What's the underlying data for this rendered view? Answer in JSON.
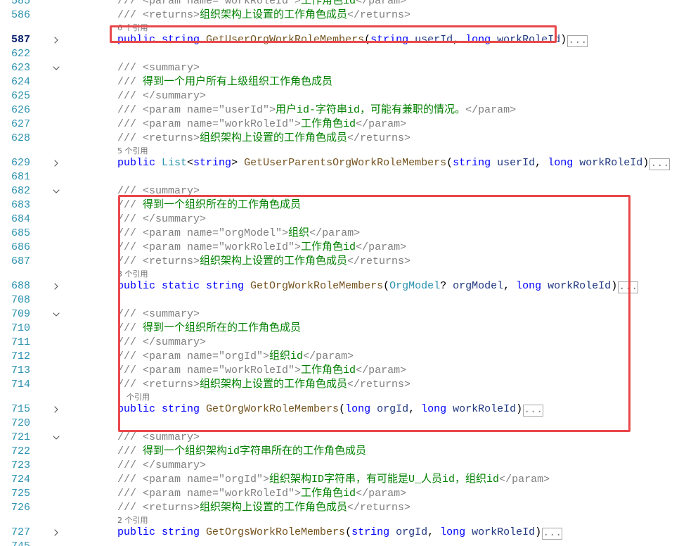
{
  "theme": {
    "background": "#FFFFFF",
    "line_number": "#2B91AF",
    "current_line_number": "#0B216F",
    "keyword": "#0000FF",
    "method": "#74531F",
    "type": "#2B91AF",
    "param": "#1F377F",
    "punct": "#000000",
    "doc_tag": "#808080",
    "doc_text": "#008000",
    "codelens": "#6F6F6F",
    "fold_chevron": "#5A5A5A",
    "ellipsis_border": "#A5A5A5",
    "ellipsis_text": "#808080",
    "annotation": "#E8484B"
  },
  "editor": {
    "lines": [
      {
        "num": "585",
        "tokens": [
          {
            "doc_tag": "/// <param name=\"workRoleId\">"
          },
          {
            "doc_text": "工作角色id"
          },
          {
            "doc_tag": "</param>"
          }
        ]
      },
      {
        "num": "586",
        "tokens": [
          {
            "doc_tag": "/// <returns>"
          },
          {
            "doc_text": "组织架构上设置的工作角色成员"
          },
          {
            "doc_tag": "</returns>"
          }
        ]
      },
      {
        "num": "587",
        "current": true,
        "fold_icon": "chevron-right-icon",
        "codelens": "6 个引用",
        "tokens": [
          {
            "keyword": "public "
          },
          {
            "keyword": "string "
          },
          {
            "method": "GetUserOrgWorkRoleMembers"
          },
          {
            "punct": "("
          },
          {
            "keyword": "string "
          },
          {
            "param": "userId"
          },
          {
            "punct": ", "
          },
          {
            "keyword": "long "
          },
          {
            "param": "workRoleId"
          },
          {
            "punct": ")"
          }
        ],
        "ellipsis": "..."
      },
      {
        "num": "622",
        "tokens": []
      },
      {
        "num": "623",
        "fold_icon": "chevron-down-icon",
        "tokens": [
          {
            "doc_tag": "/// <summary>"
          }
        ]
      },
      {
        "num": "624",
        "tokens": [
          {
            "doc_tag": "/// "
          },
          {
            "doc_text": "得到一个用户所有上级组织工作角色成员"
          }
        ]
      },
      {
        "num": "625",
        "tokens": [
          {
            "doc_tag": "/// </summary>"
          }
        ]
      },
      {
        "num": "626",
        "tokens": [
          {
            "doc_tag": "/// <param name=\"userId\">"
          },
          {
            "doc_text": "用户id-字符串id，可能有兼职的情况。"
          },
          {
            "doc_tag": "</param>"
          }
        ]
      },
      {
        "num": "627",
        "tokens": [
          {
            "doc_tag": "/// <param name=\"workRoleId\">"
          },
          {
            "doc_text": "工作角色id"
          },
          {
            "doc_tag": "</param>"
          }
        ]
      },
      {
        "num": "628",
        "tokens": [
          {
            "doc_tag": "/// <returns>"
          },
          {
            "doc_text": "组织架构上设置的工作角色成员"
          },
          {
            "doc_tag": "</returns>"
          }
        ]
      },
      {
        "num": "629",
        "fold_icon": "chevron-right-icon",
        "codelens": "5 个引用",
        "tokens": [
          {
            "keyword": "public "
          },
          {
            "type": "List"
          },
          {
            "punct": "<"
          },
          {
            "keyword": "string"
          },
          {
            "punct": "> "
          },
          {
            "method": "GetUserParentsOrgWorkRoleMembers"
          },
          {
            "punct": "("
          },
          {
            "keyword": "string "
          },
          {
            "param": "userId"
          },
          {
            "punct": ", "
          },
          {
            "keyword": "long "
          },
          {
            "param": "workRoleId"
          },
          {
            "punct": ")"
          }
        ],
        "ellipsis": "..."
      },
      {
        "num": "681",
        "tokens": []
      },
      {
        "num": "682",
        "fold_icon": "chevron-down-icon",
        "tokens": [
          {
            "doc_tag": "/// <summary>"
          }
        ]
      },
      {
        "num": "683",
        "tokens": [
          {
            "doc_tag": "/// "
          },
          {
            "doc_text": "得到一个组织所在的工作角色成员"
          }
        ]
      },
      {
        "num": "684",
        "tokens": [
          {
            "doc_tag": "/// </summary>"
          }
        ]
      },
      {
        "num": "685",
        "tokens": [
          {
            "doc_tag": "/// <param name=\"orgModel\">"
          },
          {
            "doc_text": "组织"
          },
          {
            "doc_tag": "</param>"
          }
        ]
      },
      {
        "num": "686",
        "tokens": [
          {
            "doc_tag": "/// <param name=\"workRoleId\">"
          },
          {
            "doc_text": "工作角色id"
          },
          {
            "doc_tag": "</param>"
          }
        ]
      },
      {
        "num": "687",
        "tokens": [
          {
            "doc_tag": "/// <returns>"
          },
          {
            "doc_text": "组织架构上设置的工作角色成员"
          },
          {
            "doc_tag": "</returns>"
          }
        ]
      },
      {
        "num": "688",
        "fold_icon": "chevron-right-icon",
        "codelens": "3 个引用",
        "tokens": [
          {
            "keyword": "public "
          },
          {
            "keyword": "static "
          },
          {
            "keyword": "string "
          },
          {
            "method": "GetOrgWorkRoleMembers"
          },
          {
            "punct": "("
          },
          {
            "type": "OrgModel"
          },
          {
            "punct": "? "
          },
          {
            "param": "orgModel"
          },
          {
            "punct": ", "
          },
          {
            "keyword": "long "
          },
          {
            "param": "workRoleId"
          },
          {
            "punct": ")"
          }
        ],
        "ellipsis": "..."
      },
      {
        "num": "708",
        "tokens": []
      },
      {
        "num": "709",
        "fold_icon": "chevron-down-icon",
        "tokens": [
          {
            "doc_tag": "/// <summary>"
          }
        ]
      },
      {
        "num": "710",
        "tokens": [
          {
            "doc_tag": "/// "
          },
          {
            "doc_text": "得到一个组织所在的工作角色成员"
          }
        ]
      },
      {
        "num": "711",
        "tokens": [
          {
            "doc_tag": "/// </summary>"
          }
        ]
      },
      {
        "num": "712",
        "tokens": [
          {
            "doc_tag": "/// <param name=\"orgId\">"
          },
          {
            "doc_text": "组织id"
          },
          {
            "doc_tag": "</param>"
          }
        ]
      },
      {
        "num": "713",
        "tokens": [
          {
            "doc_tag": "/// <param name=\"workRoleId\">"
          },
          {
            "doc_text": "工作角色id"
          },
          {
            "doc_tag": "</param>"
          }
        ]
      },
      {
        "num": "714",
        "tokens": [
          {
            "doc_tag": "/// <returns>"
          },
          {
            "doc_text": "组织架构上设置的工作角色成员"
          },
          {
            "doc_tag": "</returns>"
          }
        ]
      },
      {
        "num": "715",
        "fold_icon": "chevron-right-icon",
        "codelens": "个引用",
        "tokens": [
          {
            "keyword": "public "
          },
          {
            "keyword": "string "
          },
          {
            "method": "GetOrgWorkRoleMembers"
          },
          {
            "punct": "("
          },
          {
            "keyword": "long "
          },
          {
            "param": "orgId"
          },
          {
            "punct": ", "
          },
          {
            "keyword": "long "
          },
          {
            "param": "workRoleId"
          },
          {
            "punct": ")"
          }
        ],
        "ellipsis": "..."
      },
      {
        "num": "720",
        "tokens": []
      },
      {
        "num": "721",
        "fold_icon": "chevron-down-icon",
        "tokens": [
          {
            "doc_tag": "/// <summary>"
          }
        ]
      },
      {
        "num": "722",
        "tokens": [
          {
            "doc_tag": "/// "
          },
          {
            "doc_text": "得到一个组织架构id字符串所在的工作角色成员"
          }
        ]
      },
      {
        "num": "723",
        "tokens": [
          {
            "doc_tag": "/// </summary>"
          }
        ]
      },
      {
        "num": "724",
        "tokens": [
          {
            "doc_tag": "/// <param name=\"orgId\">"
          },
          {
            "doc_text": "组织架构ID字符串，有可能是U_人员id，组织id"
          },
          {
            "doc_tag": "</param>"
          }
        ]
      },
      {
        "num": "725",
        "tokens": [
          {
            "doc_tag": "/// <param name=\"workRoleId\">"
          },
          {
            "doc_text": "工作角色id"
          },
          {
            "doc_tag": "</param>"
          }
        ]
      },
      {
        "num": "726",
        "tokens": [
          {
            "doc_tag": "/// <returns>"
          },
          {
            "doc_text": "组织架构上设置的工作角色成员"
          },
          {
            "doc_tag": "</returns>"
          }
        ]
      },
      {
        "num": "727",
        "fold_icon": "chevron-right-icon",
        "codelens": "2 个引用",
        "tokens": [
          {
            "keyword": "public "
          },
          {
            "keyword": "string "
          },
          {
            "method": "GetOrgsWorkRoleMembers"
          },
          {
            "punct": "("
          },
          {
            "keyword": "string "
          },
          {
            "param": "orgId"
          },
          {
            "punct": ", "
          },
          {
            "keyword": "long "
          },
          {
            "param": "workRoleId"
          },
          {
            "punct": ")"
          }
        ],
        "ellipsis": "..."
      },
      {
        "num": "745",
        "tokens": []
      }
    ]
  }
}
